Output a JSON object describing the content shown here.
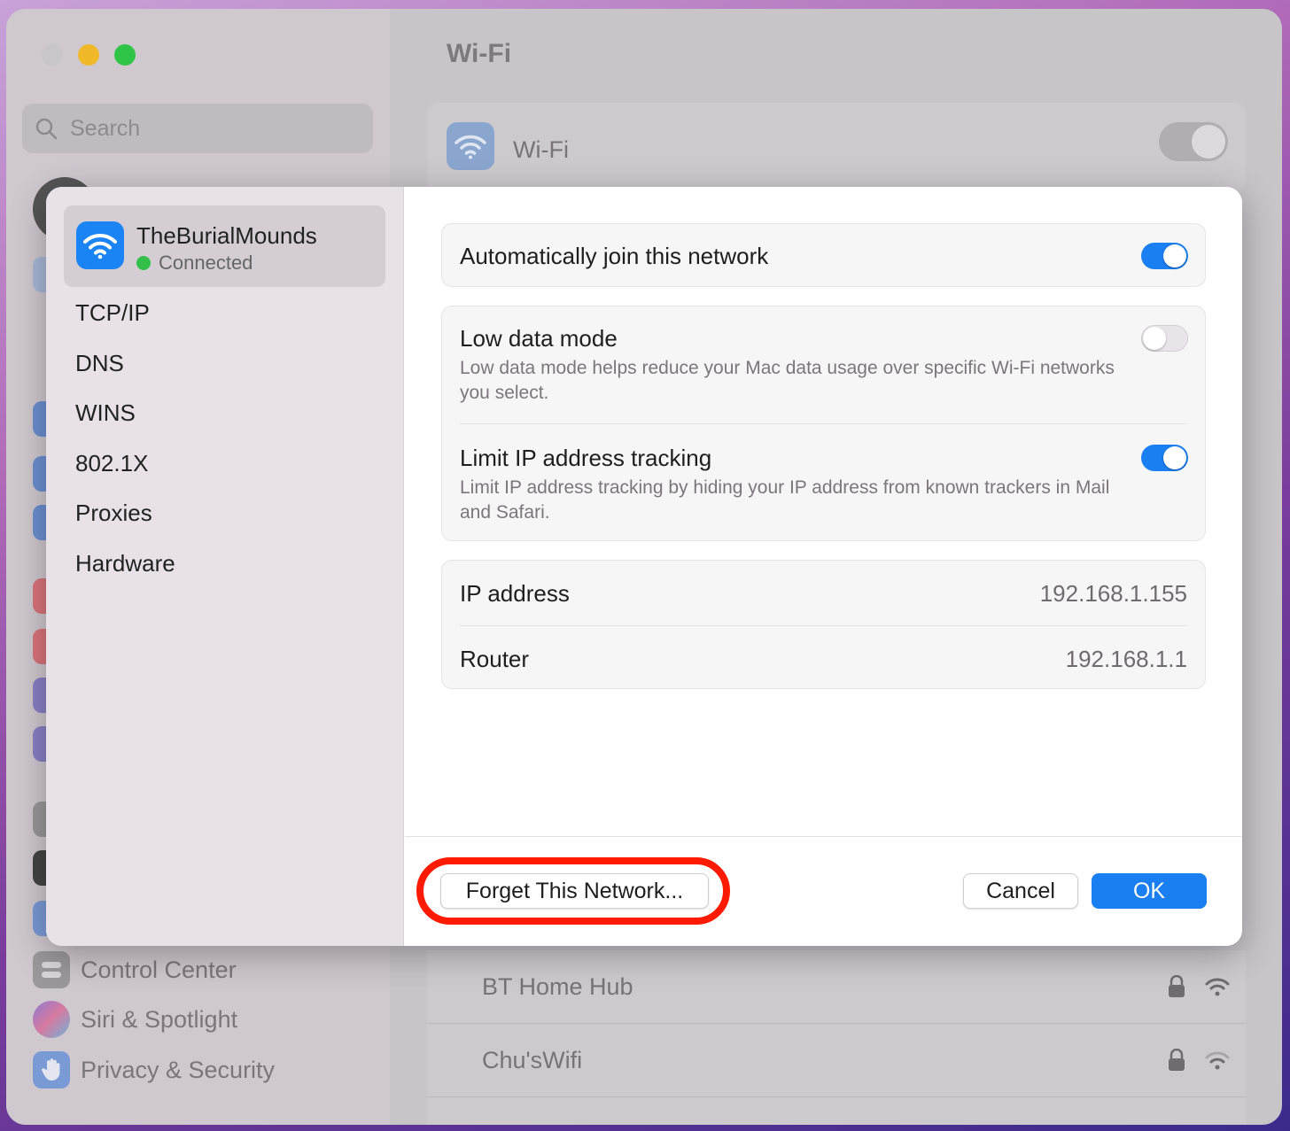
{
  "window": {
    "search_placeholder": "Search",
    "sidebar_items": [
      {
        "label": "Control Center",
        "icon": "control-center-icon"
      },
      {
        "label": "Siri & Spotlight",
        "icon": "siri-icon"
      },
      {
        "label": "Privacy & Security",
        "icon": "hand-icon"
      }
    ],
    "main_title": "Wi-Fi",
    "wifi_label": "Wi-Fi",
    "networks": [
      {
        "name": "BT Home Hub"
      },
      {
        "name": "Chu'sWifi"
      }
    ]
  },
  "sheet": {
    "network_name": "TheBurialMounds",
    "network_status": "Connected",
    "nav": [
      "TCP/IP",
      "DNS",
      "WINS",
      "802.1X",
      "Proxies",
      "Hardware"
    ],
    "auto_join": {
      "label": "Automatically join this network",
      "enabled": true
    },
    "low_data": {
      "label": "Low data mode",
      "desc": "Low data mode helps reduce your Mac data usage over specific Wi-Fi networks you select.",
      "enabled": false
    },
    "limit_ip": {
      "label": "Limit IP address tracking",
      "desc": "Limit IP address tracking by hiding your IP address from known trackers in Mail and Safari.",
      "enabled": true
    },
    "ip_address": {
      "label": "IP address",
      "value": "192.168.1.155"
    },
    "router": {
      "label": "Router",
      "value": "192.168.1.1"
    },
    "buttons": {
      "forget": "Forget This Network...",
      "cancel": "Cancel",
      "ok": "OK"
    }
  },
  "colors": {
    "accent": "#1a7ff0",
    "highlight": "#ff1a00",
    "connected": "#32c04a"
  }
}
